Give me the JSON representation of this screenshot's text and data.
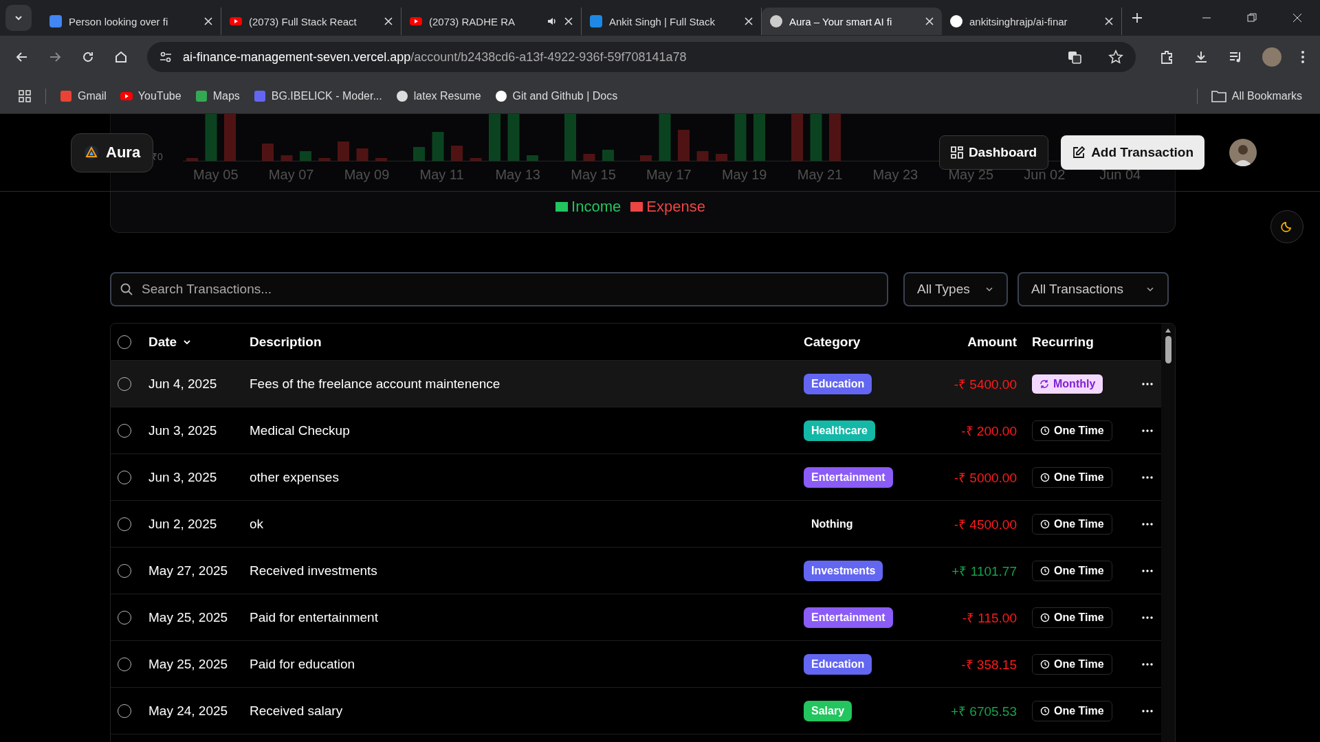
{
  "browser": {
    "tabs": [
      {
        "title": "Person looking over fi",
        "kind": "doc",
        "audio": false,
        "selected": false
      },
      {
        "title": "(2073) Full Stack React",
        "kind": "youtube",
        "audio": false,
        "selected": false
      },
      {
        "title": "(2073) RADHE RA",
        "kind": "youtube",
        "audio": true,
        "selected": false
      },
      {
        "title": "Ankit Singh | Full Stack",
        "kind": "briefcase",
        "audio": false,
        "selected": false
      },
      {
        "title": "Aura – Your smart AI fi",
        "kind": "aura",
        "audio": false,
        "selected": true
      },
      {
        "title": "ankitsinghrajp/ai-finar",
        "kind": "github",
        "audio": false,
        "selected": false
      }
    ],
    "url_host": "ai-finance-management-seven.vercel.app",
    "url_path": "/account/b2438cd6-a13f-4922-936f-59f708141a78",
    "bookmarks": [
      {
        "label": "Gmail",
        "kind": "gmail"
      },
      {
        "label": "YouTube",
        "kind": "youtube"
      },
      {
        "label": "Maps",
        "kind": "maps"
      },
      {
        "label": "BG.IBELICK - Moder...",
        "kind": "hash"
      },
      {
        "label": "latex Resume",
        "kind": "six"
      },
      {
        "label": "Git and Github | Docs",
        "kind": "gear"
      }
    ],
    "all_bookmarks": "All Bookmarks"
  },
  "header": {
    "logo": "Aura",
    "dashboard": "Dashboard",
    "add_transaction": "Add Transaction"
  },
  "chart": {
    "y_tick": "₹0",
    "x_labels": [
      "May 05",
      "May 07",
      "May 09",
      "May 11",
      "May 13",
      "May 15",
      "May 17",
      "May 19",
      "May 21",
      "May 23",
      "May 25",
      "Jun 02",
      "Jun 04"
    ],
    "legend": [
      {
        "label": "Income",
        "color": "#22c55e"
      },
      {
        "label": "Expense",
        "color": "#ef4444"
      }
    ]
  },
  "filters": {
    "search_placeholder": "Search Transactions...",
    "type": "All Types",
    "recurring": "All Transactions"
  },
  "table": {
    "select_all": {
      "checked": false
    },
    "columns": [
      "Date",
      "Description",
      "Category",
      "Amount",
      "Recurring"
    ],
    "rows": [
      {
        "date": "Jun 4, 2025",
        "description": "Fees of the freelance account maintenence",
        "category": {
          "label": "Education",
          "color": "#6366f1"
        },
        "amount": {
          "text": "-₹ 5400.00",
          "kind": "expense"
        },
        "recurring": {
          "label": "Monthly",
          "kind": "recurring"
        },
        "checked": false,
        "highlighted": true
      },
      {
        "date": "Jun 3, 2025",
        "description": "Medical Checkup",
        "category": {
          "label": "Healthcare",
          "color": "#14b8a6"
        },
        "amount": {
          "text": "-₹ 200.00",
          "kind": "expense"
        },
        "recurring": {
          "label": "One Time",
          "kind": "once"
        },
        "checked": false,
        "highlighted": false
      },
      {
        "date": "Jun 3, 2025",
        "description": "other expenses",
        "category": {
          "label": "Entertainment",
          "color": "#8b5cf6"
        },
        "amount": {
          "text": "-₹ 5000.00",
          "kind": "expense"
        },
        "recurring": {
          "label": "One Time",
          "kind": "once"
        },
        "checked": false,
        "highlighted": false
      },
      {
        "date": "Jun 2, 2025",
        "description": "ok",
        "category": {
          "label": "Nothing"
        },
        "amount": {
          "text": "-₹ 4500.00",
          "kind": "expense"
        },
        "recurring": {
          "label": "One Time",
          "kind": "once"
        },
        "checked": false,
        "highlighted": false
      },
      {
        "date": "May 27, 2025",
        "description": "Received investments",
        "category": {
          "label": "Investments",
          "color": "#6366f1"
        },
        "amount": {
          "text": "+₹ 1101.77",
          "kind": "income"
        },
        "recurring": {
          "label": "One Time",
          "kind": "once"
        },
        "checked": false,
        "highlighted": false
      },
      {
        "date": "May 25, 2025",
        "description": "Paid for entertainment",
        "category": {
          "label": "Entertainment",
          "color": "#8b5cf6"
        },
        "amount": {
          "text": "-₹ 115.00",
          "kind": "expense"
        },
        "recurring": {
          "label": "One Time",
          "kind": "once"
        },
        "checked": false,
        "highlighted": false
      },
      {
        "date": "May 25, 2025",
        "description": "Paid for education",
        "category": {
          "label": "Education",
          "color": "#6366f1"
        },
        "amount": {
          "text": "-₹ 358.15",
          "kind": "expense"
        },
        "recurring": {
          "label": "One Time",
          "kind": "once"
        },
        "checked": false,
        "highlighted": false
      },
      {
        "date": "May 24, 2025",
        "description": "Received salary",
        "category": {
          "label": "Salary",
          "color": "#22c55e"
        },
        "amount": {
          "text": "+₹ 6705.53",
          "kind": "income"
        },
        "recurring": {
          "label": "One Time",
          "kind": "once"
        },
        "checked": false,
        "highlighted": false
      }
    ]
  }
}
